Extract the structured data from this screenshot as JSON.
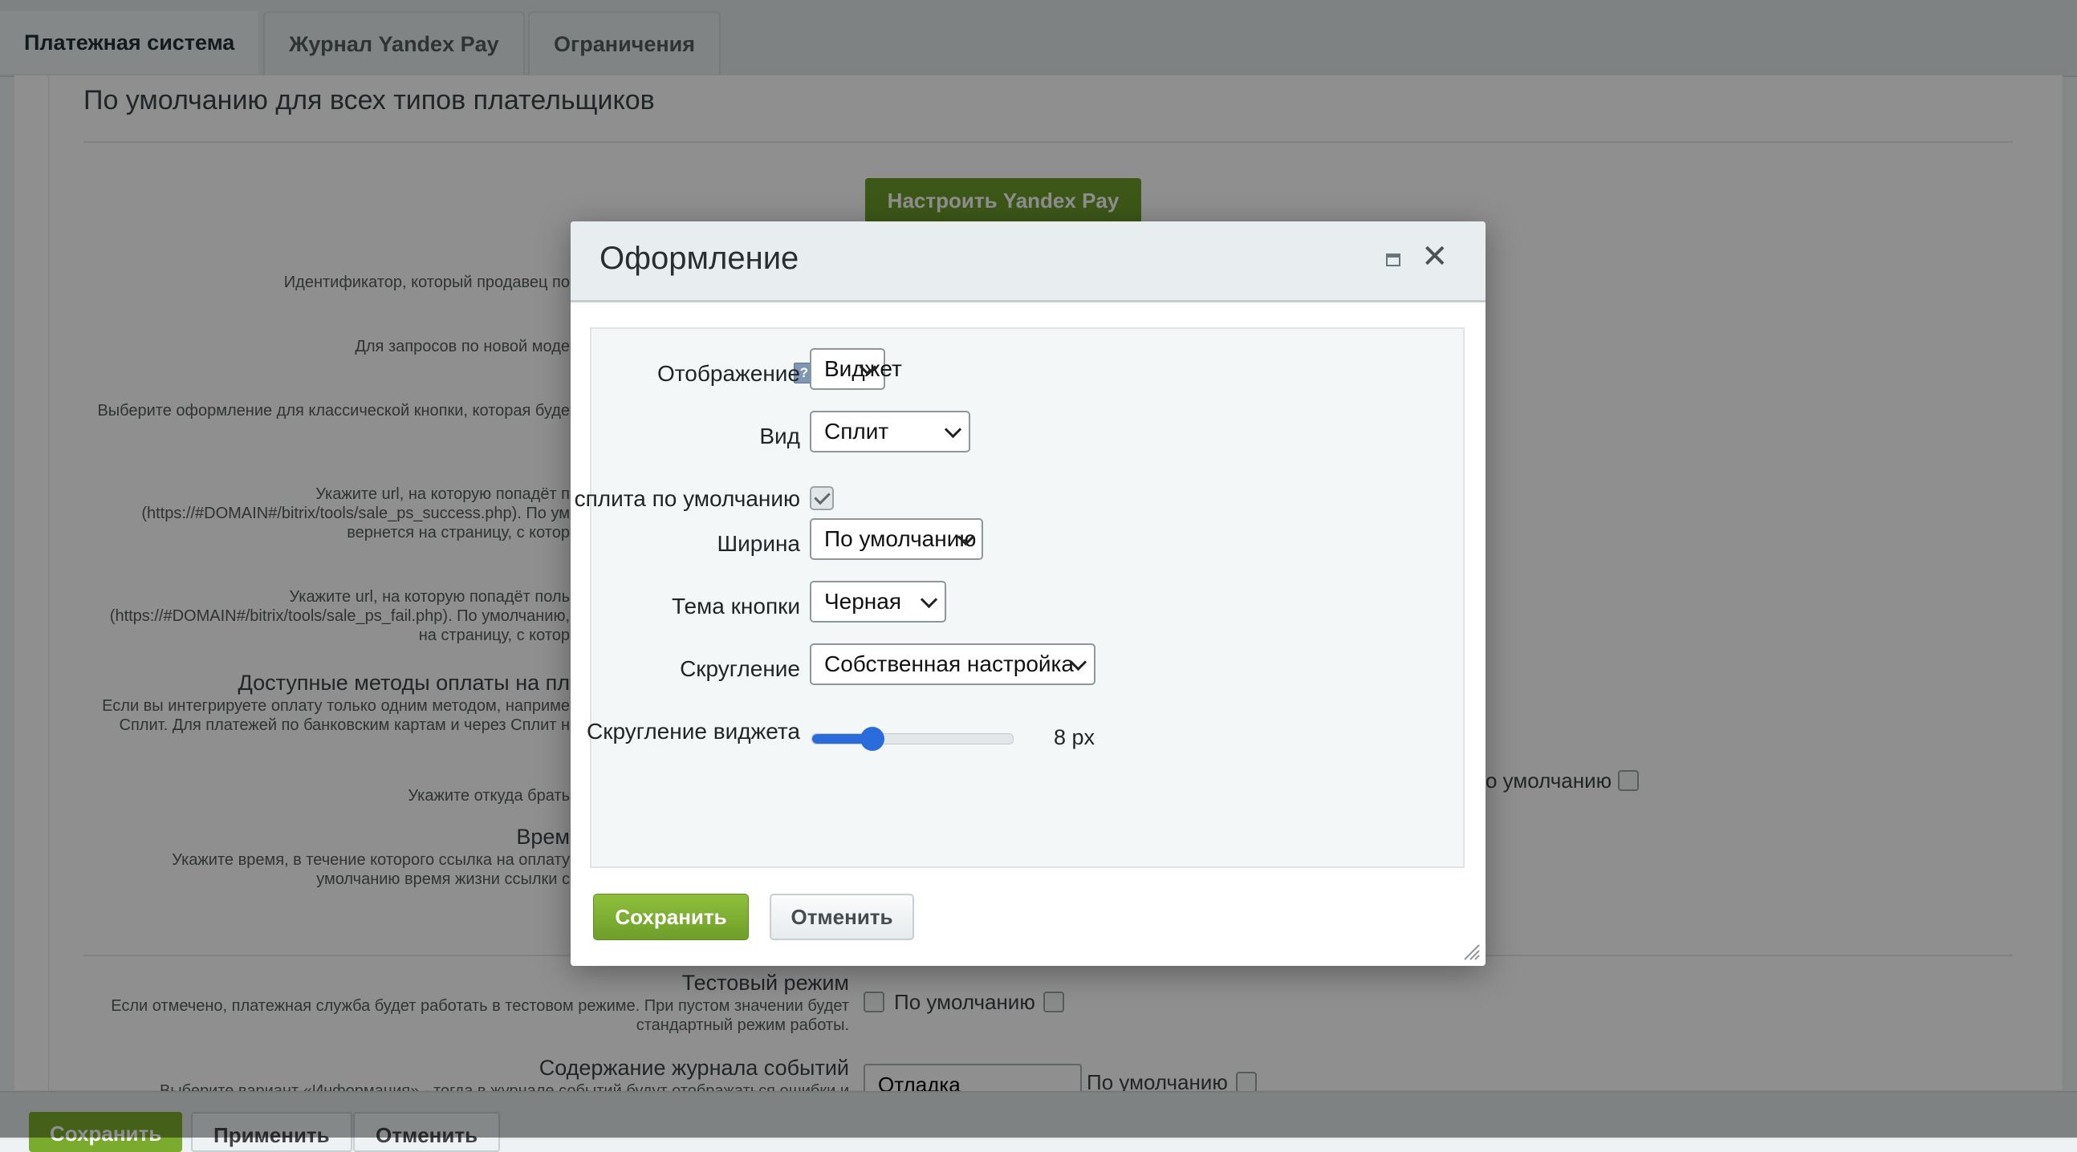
{
  "tabs": [
    {
      "label": "Платежная система"
    },
    {
      "label": "Журнал Yandex Pay"
    },
    {
      "label": "Ограничения"
    }
  ],
  "background": {
    "section_title": "По умолчанию для всех типов плательщиков",
    "setup_button": "Настроить Yandex Pay",
    "hint_seller_id": "Идентификатор, который продавец по",
    "hint_new_model": "Для запросов по новой моде",
    "hint_classic_button": "Выберите оформление для классической кнопки, которая буде",
    "hint_success_url": [
      "Укажите url, на которую попадёт п",
      "(https://#DOMAIN#/bitrix/tools/sale_ps_success.php). По ум",
      "вернется на страницу, с котор"
    ],
    "hint_fail_url": [
      "Укажите url, на которую попадёт поль",
      "(https://#DOMAIN#/bitrix/tools/sale_ps_fail.php). По умолчанию,",
      "на страницу, с котор"
    ],
    "methods_title": "Доступные методы оплаты на пл",
    "methods_hint": [
      "Если вы интегрируете оплату только одним методом, наприме",
      "Сплит. Для платежей по банковским картам и через Сплит н"
    ],
    "source_hint": "Укажите откуда брать",
    "default_right": "о умолчанию",
    "time_title": "Врем",
    "time_hint": [
      "Укажите время, в течение которого ссылка на оплату",
      "умолчанию время жизни ссылки с"
    ],
    "test_mode_title": "Тестовый режим",
    "test_mode_hint": [
      "Если отмечено, платежная служба будет работать в тестовом режиме. При пустом значении будет",
      "стандартный режим работы."
    ],
    "test_mode_default": "По умолчанию",
    "log_title": "Содержание журнала событий",
    "log_hint": "Выберите вариант «Информация» - тогда в журнале событий будут отображаться ошибки и",
    "log_select": "Отладка",
    "log_default": "По умолчанию"
  },
  "bottom_bar": {
    "save": "Сохранить",
    "apply": "Применить",
    "cancel": "Отменить"
  },
  "dialog": {
    "title": "Оформление",
    "display_label": "Отображение",
    "display_value": "Виджет",
    "type_label": "Вид",
    "type_value": "Сплит",
    "split_default_label": "Выбор сплита по умолчанию",
    "split_default_checked": true,
    "width_label": "Ширина",
    "width_value": "По умолчанию",
    "theme_label": "Тема кнопки",
    "theme_value": "Черная",
    "rounding_label": "Скругление",
    "rounding_value": "Собственная настройка",
    "widget_rounding_label": "Скругление виджета",
    "widget_rounding_value": "8 px",
    "widget_rounding_fraction": 0.3,
    "save_button": "Сохранить",
    "cancel_button": "Отменить"
  },
  "colors": {
    "accent_green": "#6f9e2a",
    "slider_blue": "#2b6cdc"
  }
}
